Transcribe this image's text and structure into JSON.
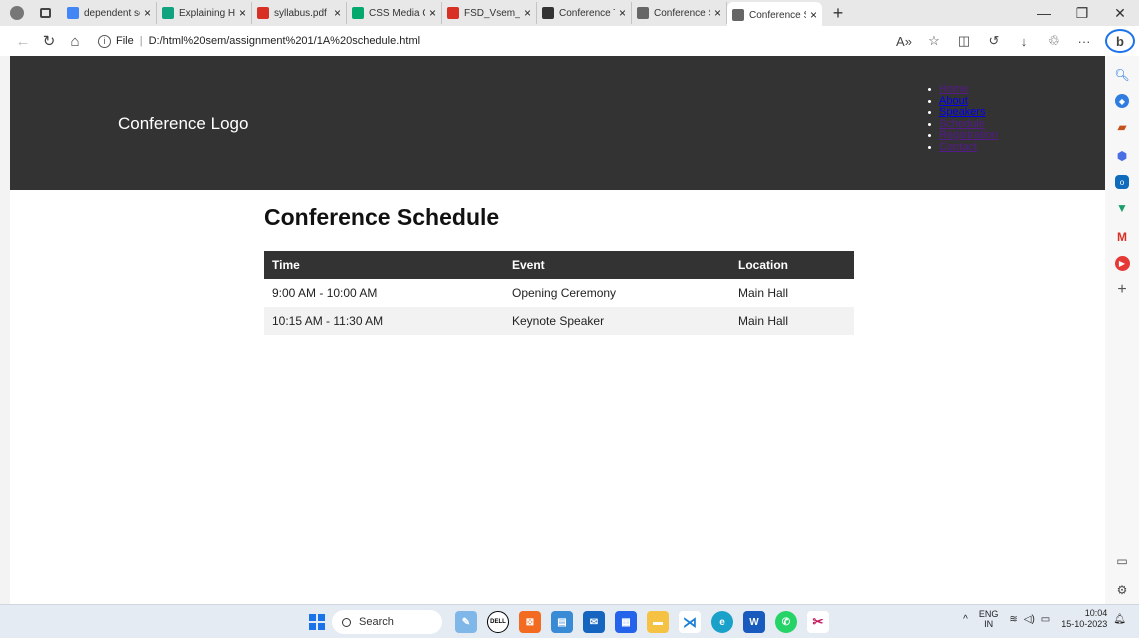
{
  "browser": {
    "tabs": [
      {
        "label": "dependent selec",
        "favicon": "google-icon",
        "color": "#4285f4"
      },
      {
        "label": "Explaining HTML",
        "favicon": "chat-icon",
        "color": "#10a37f"
      },
      {
        "label": "syllabus.pdf",
        "favicon": "pdf-icon",
        "color": "#d93025"
      },
      {
        "label": "CSS Media Quer",
        "favicon": "w3-icon",
        "color": "#04aa6d"
      },
      {
        "label": "FSD_Vsem_CSE_",
        "favicon": "pdf-icon",
        "color": "#d93025"
      },
      {
        "label": "Conference Title",
        "favicon": "logo-icon",
        "color": "#333333"
      },
      {
        "label": "Conference Spe",
        "favicon": "page-icon",
        "color": "#666666"
      },
      {
        "label": "Conference Sche",
        "favicon": "page-icon",
        "color": "#666666",
        "active": true
      }
    ],
    "address": {
      "prefix": "File",
      "url": "D:/html%20sem/assignment%201/1A%20schedule.html"
    }
  },
  "page": {
    "logo": "Conference Logo",
    "nav": [
      {
        "label": "Home",
        "color": "#551a8b"
      },
      {
        "label": "About",
        "color": "#0000ee"
      },
      {
        "label": "Speakers",
        "color": "#0000ee"
      },
      {
        "label": "Schedule",
        "color": "#551a8b"
      },
      {
        "label": "Registration",
        "color": "#551a8b"
      },
      {
        "label": "Contact",
        "color": "#551a8b"
      }
    ],
    "title": "Conference Schedule",
    "table": {
      "headers": [
        "Time",
        "Event",
        "Location"
      ],
      "rows": [
        [
          "9:00 AM - 10:00 AM",
          "Opening Ceremony",
          "Main Hall"
        ],
        [
          "10:15 AM - 11:30 AM",
          "Keynote Speaker",
          "Main Hall"
        ]
      ]
    }
  },
  "taskbar": {
    "search_label": "Search",
    "lang": "ENG",
    "region": "IN",
    "time": "10:04",
    "date": "15-10-2023"
  }
}
